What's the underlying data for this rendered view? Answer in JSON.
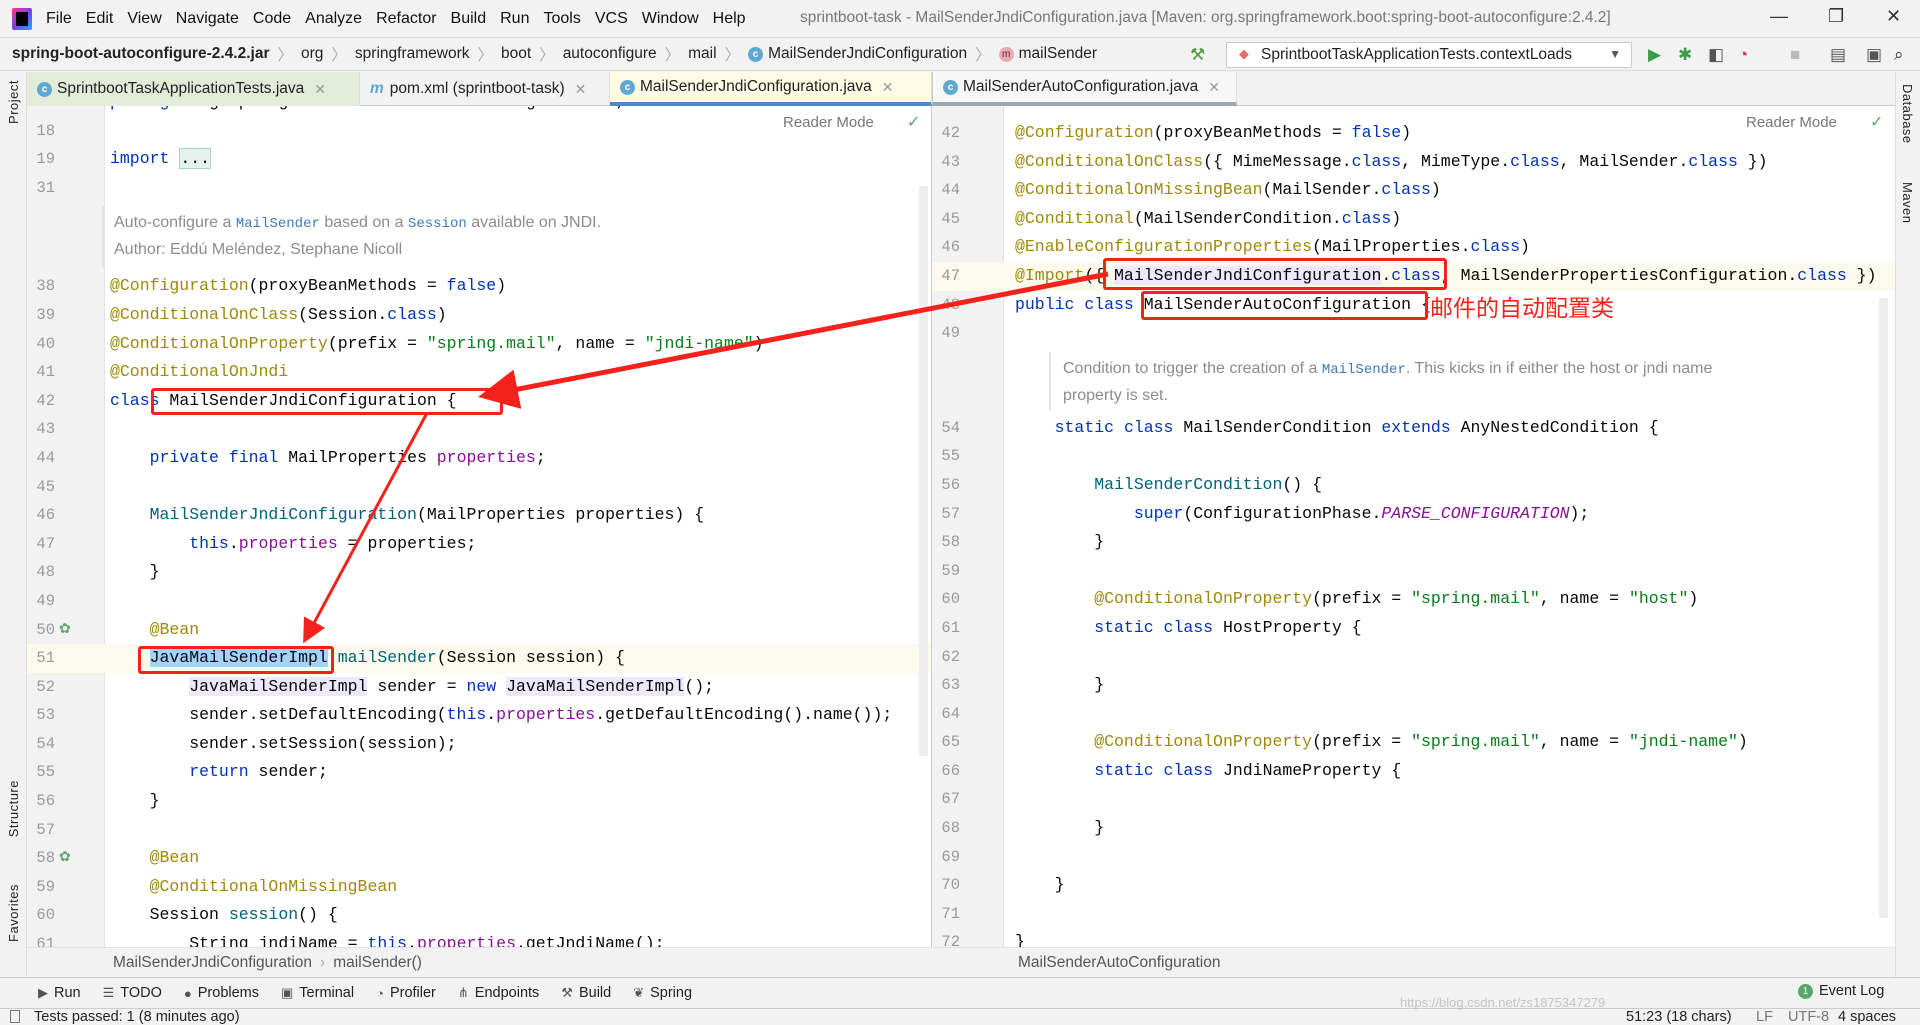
{
  "window": {
    "title": "sprintboot-task - MailSenderJndiConfiguration.java [Maven: org.springframework.boot:spring-boot-autoconfigure:2.4.2]",
    "menu": [
      "File",
      "Edit",
      "View",
      "Navigate",
      "Code",
      "Analyze",
      "Refactor",
      "Build",
      "Run",
      "Tools",
      "VCS",
      "Window",
      "Help"
    ]
  },
  "breadcrumb": [
    {
      "label": "spring-boot-autoconfigure-2.4.2.jar"
    },
    {
      "label": "org"
    },
    {
      "label": "springframework"
    },
    {
      "label": "boot"
    },
    {
      "label": "autoconfigure"
    },
    {
      "label": "mail"
    },
    {
      "label": "MailSenderJndiConfiguration",
      "icon": "class-icon"
    },
    {
      "label": "mailSender",
      "icon": "method-icon"
    }
  ],
  "run_config": "SprintbootTaskApplicationTests.contextLoads",
  "tabs": [
    {
      "label": "SprintbootTaskApplicationTests.java",
      "icon": "test-class-icon"
    },
    {
      "label": "pom.xml (sprintboot-task)",
      "icon": "maven-icon"
    },
    {
      "label": "MailSenderJndiConfiguration.java",
      "icon": "class-icon",
      "active": true
    },
    {
      "label": "MailSenderAutoConfiguration.java",
      "icon": "class-icon"
    }
  ],
  "side_left": [
    "Project",
    "Structure",
    "Favorites"
  ],
  "side_right": [
    "Database",
    "Maven"
  ],
  "reader_mode": "Reader Mode",
  "left_editor": {
    "breadcrumb": [
      "MailSenderJndiConfiguration",
      "mailSender()"
    ],
    "lines": [
      {
        "n": "17",
        "code": [
          [
            "package",
            "kw"
          ],
          [
            " org.springframework.boot.autoconfigure.mail;",
            ""
          ]
        ]
      },
      {
        "n": "18",
        "code": []
      },
      {
        "n": "19",
        "code": [
          [
            "import",
            "kw"
          ],
          [
            " ",
            ""
          ],
          [
            "...",
            "fold"
          ]
        ]
      },
      {
        "n": "31",
        "code": []
      },
      {
        "doc": [
          [
            [
              "Auto-configure a ",
              ""
            ],
            [
              "MailSender",
              "ref"
            ],
            [
              " based on a ",
              ""
            ],
            [
              "Session",
              "ref"
            ],
            [
              " available on JNDI.",
              ""
            ]
          ],
          [
            [
              "Author: Eddú Meléndez, Stephane Nicoll",
              ""
            ]
          ]
        ]
      },
      {
        "n": "38",
        "code": [
          [
            "@Configuration",
            "an"
          ],
          [
            "(proxyBeanMethods = ",
            ""
          ],
          [
            "false",
            "kw"
          ],
          [
            ")",
            ""
          ]
        ]
      },
      {
        "n": "39",
        "code": [
          [
            "@ConditionalOnClass",
            "an"
          ],
          [
            "(Session.",
            ""
          ],
          [
            "class",
            "kw"
          ],
          [
            ")",
            ""
          ]
        ]
      },
      {
        "n": "40",
        "code": [
          [
            "@ConditionalOnProperty",
            "an"
          ],
          [
            "(prefix = ",
            ""
          ],
          [
            "\"spring.mail\"",
            "st"
          ],
          [
            ", name = ",
            ""
          ],
          [
            "\"jndi-name\"",
            "st"
          ],
          [
            ")",
            ""
          ]
        ]
      },
      {
        "n": "41",
        "code": [
          [
            "@ConditionalOnJndi",
            "an"
          ]
        ]
      },
      {
        "n": "42",
        "code": [
          [
            "class",
            "kw"
          ],
          [
            " MailSenderJndiConfiguration {",
            ""
          ]
        ]
      },
      {
        "n": "43",
        "code": []
      },
      {
        "n": "44",
        "code": [
          [
            "    ",
            ""
          ],
          [
            "private",
            "kw"
          ],
          [
            " ",
            ""
          ],
          [
            "final",
            "kw"
          ],
          [
            " MailProperties ",
            ""
          ],
          [
            "properties",
            "fd"
          ],
          [
            ";",
            ""
          ]
        ]
      },
      {
        "n": "45",
        "code": []
      },
      {
        "n": "46",
        "code": [
          [
            "    ",
            ""
          ],
          [
            "MailSenderJndiConfiguration",
            "md"
          ],
          [
            "(MailProperties properties) {",
            ""
          ]
        ]
      },
      {
        "n": "47",
        "code": [
          [
            "        ",
            ""
          ],
          [
            "this",
            "kw"
          ],
          [
            ".",
            ""
          ],
          [
            "properties",
            "fd"
          ],
          [
            " = properties;",
            ""
          ]
        ]
      },
      {
        "n": "48",
        "code": [
          [
            "    }",
            ""
          ]
        ]
      },
      {
        "n": "49",
        "code": []
      },
      {
        "n": "50",
        "code": [
          [
            "    ",
            ""
          ],
          [
            "@Bean",
            "an"
          ]
        ],
        "bean": true
      },
      {
        "n": "51",
        "code": [
          [
            "    ",
            ""
          ],
          [
            "JavaMailSenderImpl",
            "sel"
          ],
          [
            " ",
            ""
          ],
          [
            "mailSender",
            "md"
          ],
          [
            "(Session session) {",
            ""
          ]
        ],
        "current": true
      },
      {
        "n": "52",
        "code": [
          [
            "        ",
            ""
          ],
          [
            "JavaMailSenderImpl",
            "hl"
          ],
          [
            " sender = ",
            ""
          ],
          [
            "new",
            "kw"
          ],
          [
            " ",
            ""
          ],
          [
            "JavaMailSenderImpl",
            "hl"
          ],
          [
            "();",
            ""
          ]
        ]
      },
      {
        "n": "53",
        "code": [
          [
            "        sender.setDefaultEncoding(",
            ""
          ],
          [
            "this",
            "kw"
          ],
          [
            ".",
            ""
          ],
          [
            "properties",
            "fd"
          ],
          [
            ".getDefaultEncoding().name());",
            ""
          ]
        ]
      },
      {
        "n": "54",
        "code": [
          [
            "        sender.setSession(session);",
            ""
          ]
        ]
      },
      {
        "n": "55",
        "code": [
          [
            "        ",
            ""
          ],
          [
            "return",
            "kw"
          ],
          [
            " sender;",
            ""
          ]
        ]
      },
      {
        "n": "56",
        "code": [
          [
            "    }",
            ""
          ]
        ]
      },
      {
        "n": "57",
        "code": []
      },
      {
        "n": "58",
        "code": [
          [
            "    ",
            ""
          ],
          [
            "@Bean",
            "an"
          ]
        ],
        "bean": true
      },
      {
        "n": "59",
        "code": [
          [
            "    ",
            ""
          ],
          [
            "@ConditionalOnMissingBean",
            "an"
          ]
        ]
      },
      {
        "n": "60",
        "code": [
          [
            "    Session ",
            ""
          ],
          [
            "session",
            "md"
          ],
          [
            "() {",
            ""
          ]
        ]
      },
      {
        "n": "61",
        "code": [
          [
            "        String jndiName = ",
            ""
          ],
          [
            "this",
            "kw"
          ],
          [
            ".",
            ""
          ],
          [
            "properties",
            "fd"
          ],
          [
            ".getJndiName();",
            ""
          ]
        ]
      }
    ]
  },
  "right_editor": {
    "breadcrumb": [
      "MailSenderAutoConfiguration"
    ],
    "lines": [
      {
        "n": "42",
        "code": [
          [
            "@Configuration",
            "an"
          ],
          [
            "(proxyBeanMethods = ",
            ""
          ],
          [
            "false",
            "kw"
          ],
          [
            ")",
            ""
          ]
        ]
      },
      {
        "n": "43",
        "code": [
          [
            "@ConditionalOnClass",
            "an"
          ],
          [
            "({ MimeMessage.",
            ""
          ],
          [
            "class",
            "kw"
          ],
          [
            ", MimeType.",
            ""
          ],
          [
            "class",
            "kw"
          ],
          [
            ", MailSender.",
            ""
          ],
          [
            "class",
            "kw"
          ],
          [
            " })",
            ""
          ]
        ]
      },
      {
        "n": "44",
        "code": [
          [
            "@ConditionalOnMissingBean",
            "an"
          ],
          [
            "(MailSender.",
            ""
          ],
          [
            "class",
            "kw"
          ],
          [
            ")",
            ""
          ]
        ]
      },
      {
        "n": "45",
        "code": [
          [
            "@Conditional",
            "an"
          ],
          [
            "(MailSenderCondition.",
            ""
          ],
          [
            "class",
            "kw"
          ],
          [
            ")",
            ""
          ]
        ]
      },
      {
        "n": "46",
        "code": [
          [
            "@EnableConfigurationProperties",
            "an"
          ],
          [
            "(MailProperties.",
            ""
          ],
          [
            "class",
            "kw"
          ],
          [
            ")",
            ""
          ]
        ]
      },
      {
        "n": "47",
        "code": [
          [
            "@Import",
            "an"
          ],
          [
            "({ ",
            ""
          ],
          [
            "MailSenderJndiConfiguration",
            "hl"
          ],
          [
            ".",
            ""
          ],
          [
            "class",
            "kw"
          ],
          [
            ", MailSenderPropertiesConfiguration.",
            ""
          ],
          [
            "class",
            "kw"
          ],
          [
            " })",
            ""
          ]
        ],
        "current": true
      },
      {
        "n": "48",
        "code": [
          [
            "public",
            "kw"
          ],
          [
            " ",
            ""
          ],
          [
            "class",
            "kw"
          ],
          [
            " MailSenderAutoConfiguration {",
            ""
          ]
        ]
      },
      {
        "n": "49",
        "code": []
      },
      {
        "doc": [
          [
            [
              "Condition to trigger the creation of a ",
              ""
            ],
            [
              "MailSender",
              "ref"
            ],
            [
              ". This kicks in if either the host or jndi name",
              ""
            ]
          ],
          [
            [
              "property is set.",
              ""
            ]
          ]
        ]
      },
      {
        "n": "54",
        "code": [
          [
            "    ",
            ""
          ],
          [
            "static",
            "kw"
          ],
          [
            " ",
            ""
          ],
          [
            "class",
            "kw"
          ],
          [
            " MailSenderCondition ",
            ""
          ],
          [
            "extends",
            "kw"
          ],
          [
            " AnyNestedCondition {",
            ""
          ]
        ]
      },
      {
        "n": "55",
        "code": []
      },
      {
        "n": "56",
        "code": [
          [
            "        ",
            ""
          ],
          [
            "MailSenderCondition",
            "md"
          ],
          [
            "() {",
            ""
          ]
        ]
      },
      {
        "n": "57",
        "code": [
          [
            "            ",
            ""
          ],
          [
            "super",
            "kw"
          ],
          [
            "(ConfigurationPhase.",
            ""
          ],
          [
            "PARSE_CONFIGURATION",
            "it"
          ],
          [
            ");",
            ""
          ]
        ]
      },
      {
        "n": "58",
        "code": [
          [
            "        }",
            ""
          ]
        ]
      },
      {
        "n": "59",
        "code": []
      },
      {
        "n": "60",
        "code": [
          [
            "        ",
            ""
          ],
          [
            "@ConditionalOnProperty",
            "an"
          ],
          [
            "(prefix = ",
            ""
          ],
          [
            "\"spring.mail\"",
            "st"
          ],
          [
            ", name = ",
            ""
          ],
          [
            "\"host\"",
            "st"
          ],
          [
            ")",
            ""
          ]
        ]
      },
      {
        "n": "61",
        "code": [
          [
            "        ",
            ""
          ],
          [
            "static",
            "kw"
          ],
          [
            " ",
            ""
          ],
          [
            "class",
            "kw"
          ],
          [
            " HostProperty {",
            ""
          ]
        ]
      },
      {
        "n": "62",
        "code": []
      },
      {
        "n": "63",
        "code": [
          [
            "        }",
            ""
          ]
        ]
      },
      {
        "n": "64",
        "code": []
      },
      {
        "n": "65",
        "code": [
          [
            "        ",
            ""
          ],
          [
            "@ConditionalOnProperty",
            "an"
          ],
          [
            "(prefix = ",
            ""
          ],
          [
            "\"spring.mail\"",
            "st"
          ],
          [
            ", name = ",
            ""
          ],
          [
            "\"jndi-name\"",
            "st"
          ],
          [
            ")",
            ""
          ]
        ]
      },
      {
        "n": "66",
        "code": [
          [
            "        ",
            ""
          ],
          [
            "static",
            "kw"
          ],
          [
            " ",
            ""
          ],
          [
            "class",
            "kw"
          ],
          [
            " JndiNameProperty {",
            ""
          ]
        ]
      },
      {
        "n": "67",
        "code": []
      },
      {
        "n": "68",
        "code": [
          [
            "        }",
            ""
          ]
        ]
      },
      {
        "n": "69",
        "code": []
      },
      {
        "n": "70",
        "code": [
          [
            "    }",
            ""
          ]
        ]
      },
      {
        "n": "71",
        "code": []
      },
      {
        "n": "72",
        "code": [
          [
            "}",
            ""
          ]
        ]
      }
    ]
  },
  "annotation_note": "邮件的自动配置类",
  "tool_windows": [
    {
      "label": "Run",
      "icon": "run-icon"
    },
    {
      "label": "TODO",
      "icon": "todo-icon"
    },
    {
      "label": "Problems",
      "icon": "problems-icon"
    },
    {
      "label": "Terminal",
      "icon": "terminal-icon"
    },
    {
      "label": "Profiler",
      "icon": "profiler-icon"
    },
    {
      "label": "Endpoints",
      "icon": "endpoints-icon"
    },
    {
      "label": "Build",
      "icon": "build-icon"
    },
    {
      "label": "Spring",
      "icon": "spring-icon"
    }
  ],
  "event_log": {
    "label": "Event Log",
    "count": "1"
  },
  "status": {
    "message": "Tests passed: 1 (8 minutes ago)",
    "position": "51:23 (18 chars)",
    "line_sep": "LF",
    "encoding": "UTF-8",
    "indent": "4 spaces",
    "watermark": "https://blog.csdn.net/zs1875347279"
  },
  "colors": {
    "annotation_red": "#f5221b",
    "keyword": "#0033b3",
    "annotation": "#9e880d",
    "string": "#067d17",
    "field": "#871094"
  }
}
